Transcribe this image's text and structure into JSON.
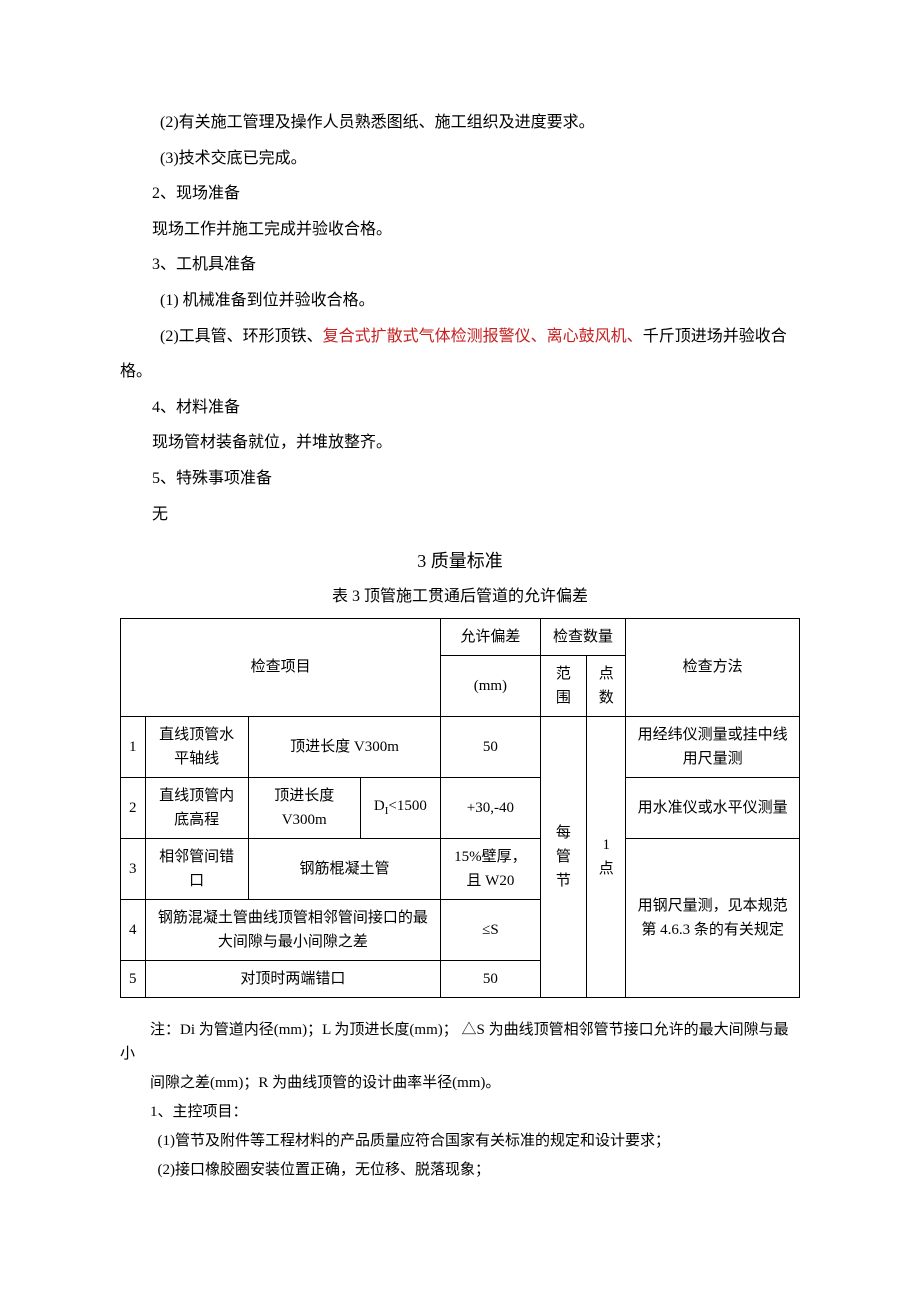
{
  "paragraphs": {
    "p1": "(2)有关施工管理及操作人员熟悉图纸、施工组织及进度要求。",
    "p2": "(3)技术交底已完成。",
    "p3": "2、现场准备",
    "p4": "现场工作并施工完成并验收合格。",
    "p5": "3、工机具准备",
    "p6": "(1) 机械准备到位并验收合格。",
    "p7_a": "(2)工具管、环形顶铁、",
    "p7_b": "复合式扩散式气体检测报警仪、离心鼓风机、",
    "p7_c": "千斤顶进场并验收合",
    "p7_end": "格。",
    "p8": "4、材料准备",
    "p9": "现场管材装备就位，并堆放整齐。",
    "p10": "5、特殊事项准备",
    "p11": "无"
  },
  "section_title": "3 质量标准",
  "table_caption": "表 3 顶管施工贯通后管道的允许偏差",
  "table": {
    "head": {
      "c1": "检查项目",
      "c2a": "允许偏差",
      "c2b": "(mm)",
      "c3": "检查数量",
      "c3a": "范围",
      "c3b": "点数",
      "c4": "检查方法"
    },
    "rows": {
      "r1": {
        "n": "1",
        "item": "直线顶管水平轴线",
        "cond": "顶进长度 V300m",
        "dev": "50",
        "method": "用经纬仪测量或挂中线用尺量测"
      },
      "r2": {
        "n": "2",
        "item": "直线顶管内底高程",
        "condA": "顶进长度 V300m",
        "condB_pre": "D",
        "condB_sub": "I",
        "condB_post": "<1500",
        "dev": "+30,-40",
        "method": "用水准仪或水平仪测量"
      },
      "r3": {
        "n": "3",
        "item": "相邻管间错口",
        "cond": "钢筋棍凝土管",
        "dev": "15%壁厚，且 W20"
      },
      "r4": {
        "n": "4",
        "item": "钢筋混凝土管曲线顶管相邻管间接口的最大间隙与最小间隙之差",
        "dev": "≤S"
      },
      "r5": {
        "n": "5",
        "item": "对顶时两端错口",
        "dev": "50"
      },
      "scope": "每管节",
      "count": "1 点",
      "method34": "用钢尺量测，见本规范第 4.6.3 条的有关规定"
    }
  },
  "notes": {
    "n1": "注：Di 为管道内径(mm)；L 为顶进长度(mm)； △S 为曲线顶管相邻管节接口允许的最大间隙与最小",
    "n2": "间隙之差(mm)；R 为曲线顶管的设计曲率半径(mm)。",
    "n3": "1、主控项目：",
    "n4": "(1)管节及附件等工程材料的产品质量应符合国家有关标准的规定和设计要求；",
    "n5": "(2)接口橡胶圈安装位置正确，无位移、脱落现象；"
  }
}
